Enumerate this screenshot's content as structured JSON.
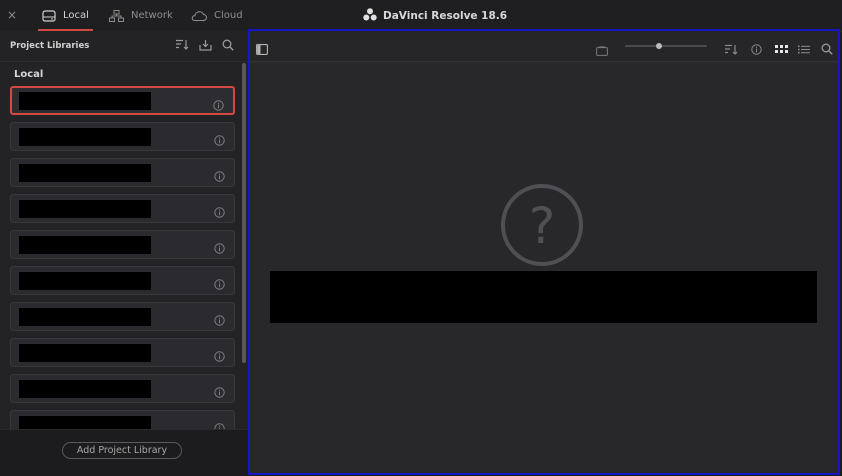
{
  "header": {
    "app_title": "DaVinci Resolve 18.6",
    "close_glyph": "×",
    "tabs": [
      {
        "label": "Local",
        "icon": "drive-icon",
        "active": true
      },
      {
        "label": "Network",
        "icon": "network-icon",
        "active": false
      },
      {
        "label": "Cloud",
        "icon": "cloud-icon",
        "active": false
      }
    ]
  },
  "left_panel": {
    "title": "Project Libraries",
    "section_label": "Local",
    "libraries": [
      {
        "name": "",
        "selected": true
      },
      {
        "name": "",
        "selected": false
      },
      {
        "name": "",
        "selected": false
      },
      {
        "name": "",
        "selected": false
      },
      {
        "name": "",
        "selected": false
      },
      {
        "name": "",
        "selected": false
      },
      {
        "name": "",
        "selected": false
      },
      {
        "name": "",
        "selected": false
      },
      {
        "name": "",
        "selected": false
      },
      {
        "name": "",
        "selected": false
      }
    ],
    "add_button_label": "Add Project Library"
  },
  "right_panel": {
    "empty_icon_glyph": "?",
    "empty_message": ""
  },
  "colors": {
    "accent_red": "#d34b40",
    "selection_blue": "#1616c8",
    "background": "#1c1c1e"
  }
}
